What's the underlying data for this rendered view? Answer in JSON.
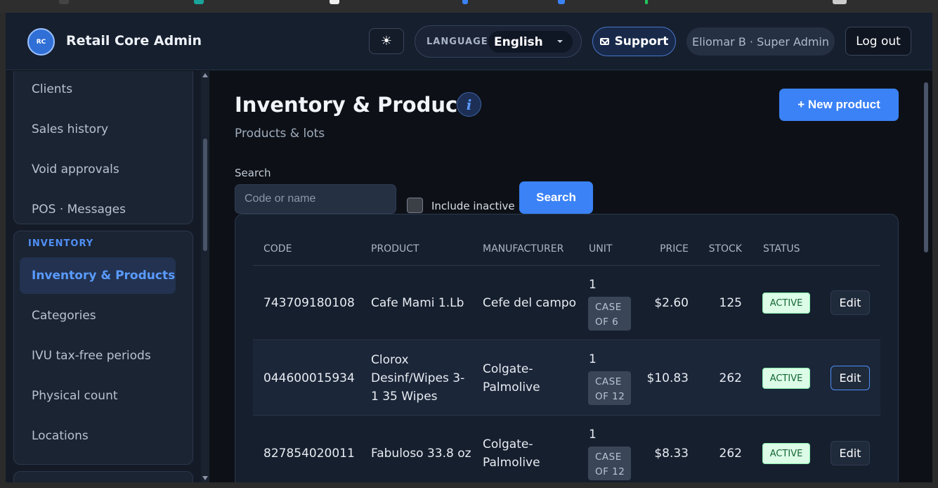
{
  "header": {
    "logo_text": "RC",
    "brand": "Retail Core Admin",
    "language_label": "LANGUAGE",
    "language_value": "English",
    "support_label": "Support",
    "user_label": "Eliomar B · Super Admin",
    "logout_label": "Log out"
  },
  "sidebar": {
    "top_items": [
      "Clients",
      "Sales history",
      "Void approvals",
      "POS · Messages"
    ],
    "inventory_section": "INVENTORY",
    "inventory_items": [
      "Inventory & Products",
      "Categories",
      "IVU tax-free periods",
      "Physical count",
      "Locations"
    ],
    "active_item": "Inventory & Products"
  },
  "main": {
    "title": "Inventory & Products",
    "subtitle": "Products & lots",
    "new_button": "+ New product",
    "search_label": "Search",
    "search_placeholder": "Code or name",
    "include_inactive_label": "Include inactive",
    "search_button": "Search"
  },
  "table": {
    "columns": [
      "CODE",
      "PRODUCT",
      "MANUFACTURER",
      "UNIT",
      "PRICE",
      "STOCK",
      "STATUS"
    ],
    "rows": [
      {
        "code": "743709180108",
        "product": "Cafe Mami 1.Lb",
        "manufacturer": "Cefe del campo",
        "unit_qty": "1",
        "unit_badge": "CASE OF 6",
        "price": "$2.60",
        "stock": "125",
        "status": "ACTIVE",
        "action": "Edit"
      },
      {
        "code": "044600015934",
        "product": "Clorox Desinf/Wipes 3-1 35 Wipes",
        "manufacturer": "Colgate-Palmolive",
        "unit_qty": "1",
        "unit_badge": "CASE OF 12",
        "price": "$10.83",
        "stock": "262",
        "status": "ACTIVE",
        "action": "Edit"
      },
      {
        "code": "827854020011",
        "product": "Fabuloso 33.8 oz",
        "manufacturer": "Colgate-Palmolive",
        "unit_qty": "1",
        "unit_badge": "CASE OF 12",
        "price": "$8.33",
        "stock": "262",
        "status": "ACTIVE",
        "action": "Edit"
      }
    ]
  },
  "colors": {
    "accent": "#3b82f6",
    "active_badge_bg": "#dcfce7",
    "active_badge_text": "#166534"
  }
}
